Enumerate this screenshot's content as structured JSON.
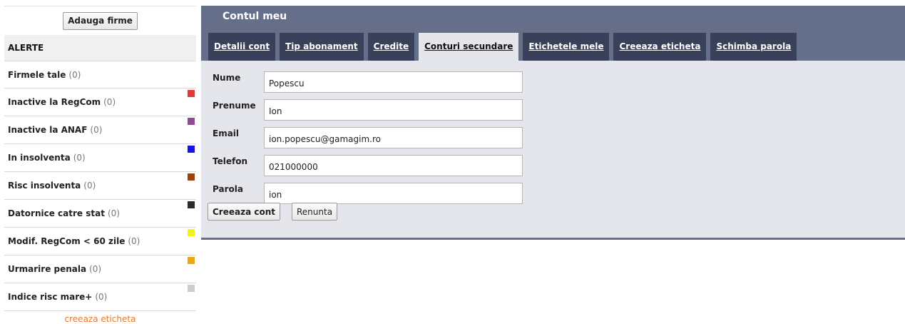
{
  "sidebar": {
    "add_button": "Adauga firme",
    "alerts_title": "ALERTE",
    "items": [
      {
        "label": "Firmele tale",
        "count": "(0)",
        "color": ""
      },
      {
        "label": "Inactive la RegCom",
        "count": "(0)",
        "color": "#e53935"
      },
      {
        "label": "Inactive la ANAF",
        "count": "(0)",
        "color": "#8e4b8f"
      },
      {
        "label": "In insolventa",
        "count": "(0)",
        "color": "#1414e6"
      },
      {
        "label": "Risc insolventa",
        "count": "(0)",
        "color": "#a0420c"
      },
      {
        "label": "Datornice catre stat",
        "count": "(0)",
        "color": "#2b2b2b"
      },
      {
        "label": "Modif. RegCom < 60 zile",
        "count": "(0)",
        "color": "#f2f21c"
      },
      {
        "label": "Urmarire penala",
        "count": "(0)",
        "color": "#f2a60f"
      },
      {
        "label": "Indice risc mare+",
        "count": "(0)",
        "color": "#cccccc"
      }
    ],
    "create_label_link": "creeaza eticheta"
  },
  "main": {
    "title": "Contul meu",
    "tabs": [
      {
        "label": "Detalii cont",
        "active": false
      },
      {
        "label": "Tip abonament",
        "active": false
      },
      {
        "label": "Credite",
        "active": false
      },
      {
        "label": "Conturi secundare",
        "active": true
      },
      {
        "label": "Etichetele mele",
        "active": false
      },
      {
        "label": "Creeaza eticheta",
        "active": false
      },
      {
        "label": "Schimba parola",
        "active": false
      }
    ],
    "form": {
      "nume": {
        "label": "Nume",
        "value": "Popescu"
      },
      "prenume": {
        "label": "Prenume",
        "value": "Ion"
      },
      "email": {
        "label": "Email",
        "value": "ion.popescu@gamagim.ro"
      },
      "telefon": {
        "label": "Telefon",
        "value": "021000000"
      },
      "parola": {
        "label": "Parola",
        "value": "ion"
      }
    },
    "create_button": "Creeaza cont",
    "cancel_button": "Renunta"
  },
  "colors": {
    "header_bg": "#666f8a",
    "tab_bg": "#38405a",
    "form_bg": "#e5e6ec",
    "link_orange": "#e8782a"
  }
}
